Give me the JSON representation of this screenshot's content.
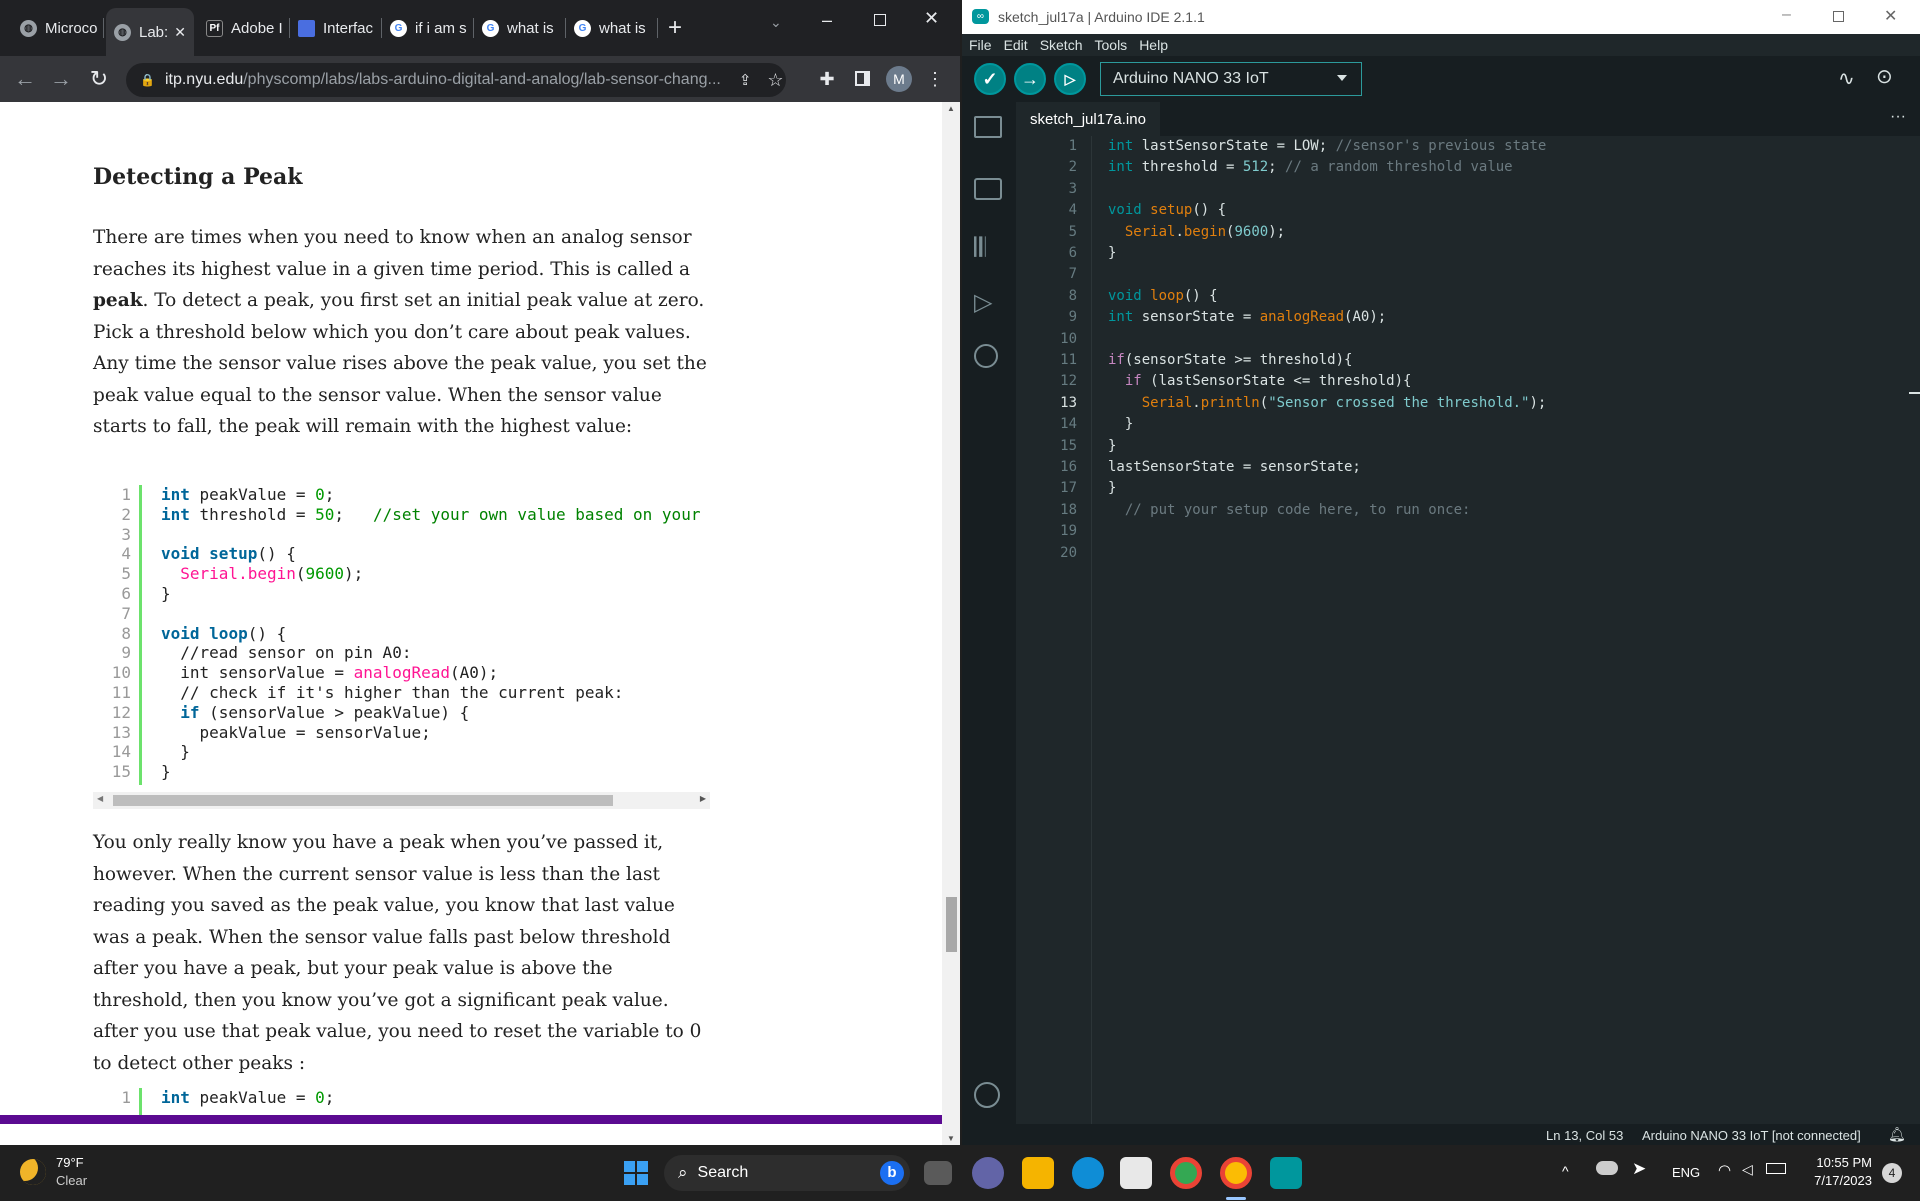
{
  "browser": {
    "tabs": [
      {
        "label": "Microco",
        "icon": "globe-icon"
      },
      {
        "label": "Lab:",
        "icon": "globe-icon",
        "active": true
      },
      {
        "label": "Adobe I",
        "icon": "pf-icon"
      },
      {
        "label": "Interfac",
        "icon": "doc-icon"
      },
      {
        "label": "if i am s",
        "icon": "google-icon"
      },
      {
        "label": "what is",
        "icon": "google-icon"
      },
      {
        "label": "what is",
        "icon": "google-icon"
      }
    ],
    "new_tab": "+",
    "close_tab": "✕",
    "url_host": "itp.nyu.edu",
    "url_path": "/physcomp/labs/labs-arduino-digital-and-analog/lab-sensor-chang...",
    "profile_initial": "M"
  },
  "article": {
    "heading": "Detecting a Peak",
    "para1_before": "There are times when you need to know when an analog sensor reaches its highest value in a given time period. This is called a ",
    "para1_bold": "peak",
    "para1_after": ". To detect a peak, you first set an initial peak value at zero.  Pick a threshold below which you don’t care about peak values. Any time the sensor value rises above the peak value, you set the peak value equal to the sensor value. When the sensor value starts to fall, the peak will remain with the highest value:",
    "para2": "You only really know you have a peak when you’ve passed it, however. When the current sensor value is less than the last reading you saved as the peak value, you know that last value was a peak. When the sensor value falls past below threshold after you have a peak, but your peak value is above the threshold, then you know you’ve got a significant peak value. after you use that peak value, you need to reset the variable to 0 to detect other peaks :",
    "code1": {
      "line_numbers": [
        "1",
        "2",
        "3",
        "4",
        "5",
        "6",
        "7",
        "8",
        "9",
        "10",
        "11",
        "12",
        "13",
        "14",
        "15"
      ],
      "l1a": "int",
      "l1b": " peakValue = ",
      "l1c": "0",
      "l1d": ";",
      "l2a": "int",
      "l2b": " threshold = ",
      "l2c": "50",
      "l2d": ";   ",
      "l2e": "//set your own value based on your",
      "l4a": "void",
      "l4b": " ",
      "l4c": "setup",
      "l4d": "() {",
      "l5a": "  ",
      "l5b": "Serial.begin",
      "l5c": "(",
      "l5d": "9600",
      "l5e": ");",
      "l6": "}",
      "l8a": "void",
      "l8b": " ",
      "l8c": "loop",
      "l8d": "() {",
      "l9": "  //read sensor on pin A0:",
      "l10a": "  int sensorValue = ",
      "l10b": "analogRead",
      "l10c": "(A0);",
      "l11": "  // check if it's higher than the current peak:",
      "l12a": "  ",
      "l12b": "if",
      "l12c": " (sensorValue > peakValue) {",
      "l13": "    peakValue = sensorValue;",
      "l14": "  }",
      "l15": "}"
    },
    "code2": {
      "line_number": "1",
      "l1a": "int",
      "l1b": " peakValue = ",
      "l1c": "0",
      "l1d": ";"
    }
  },
  "ide": {
    "title": "sketch_jul17a | Arduino IDE 2.1.1",
    "menu": [
      "File",
      "Edit",
      "Sketch",
      "Tools",
      "Help"
    ],
    "board": "Arduino NANO 33 IoT",
    "file_tab": "sketch_jul17a.ino",
    "more": "···",
    "line_numbers": [
      "1",
      "2",
      "3",
      "4",
      "5",
      "6",
      "7",
      "8",
      "9",
      "10",
      "11",
      "12",
      "13",
      "14",
      "15",
      "16",
      "17",
      "18",
      "19",
      "20"
    ],
    "code": {
      "c1a": "int",
      "c1b": " lastSensorState = LOW; ",
      "c1c": "//sensor's previous state",
      "c2a": "int",
      "c2b": " threshold = ",
      "c2c": "512",
      "c2d": "; ",
      "c2e": "// a random threshold value",
      "c4a": "void",
      "c4b": " ",
      "c4c": "setup",
      "c4d": "() {",
      "c5a": "  ",
      "c5b": "Serial",
      "c5c": ".",
      "c5d": "begin",
      "c5e": "(",
      "c5f": "9600",
      "c5g": ");",
      "c6": "}",
      "c8a": "void",
      "c8b": " ",
      "c8c": "loop",
      "c8d": "() {",
      "c9a": "int",
      "c9b": " sensorState = ",
      "c9c": "analogRead",
      "c9d": "(A0);",
      "c11a": "if",
      "c11b": "(sensorState >= threshold){",
      "c12a": "  ",
      "c12b": "if",
      "c12c": " (lastSensorState <= threshold){",
      "c13a": "    ",
      "c13b": "Serial",
      "c13c": ".",
      "c13d": "println",
      "c13e": "(",
      "c13f": "\"Sensor crossed the threshold.\"",
      "c13g": ");",
      "c14": "  }",
      "c15": "}",
      "c16": "lastSensorState = sensorState;",
      "c17": "}",
      "c18": "  // put your setup code here, to run once:"
    },
    "status_cursor": "Ln 13, Col 53",
    "status_board": "Arduino NANO 33 IoT [not connected]"
  },
  "taskbar": {
    "weather_temp": "79°F",
    "weather_desc": "Clear",
    "search": "Search",
    "lang": "ENG",
    "time": "10:55 PM",
    "date": "7/17/2023",
    "notif_count": "4"
  },
  "colors": {
    "arduino_teal": "#008184",
    "article_purple": "#5b0a91",
    "code_keyword": "#006699",
    "code_fn": "#ff1493"
  }
}
